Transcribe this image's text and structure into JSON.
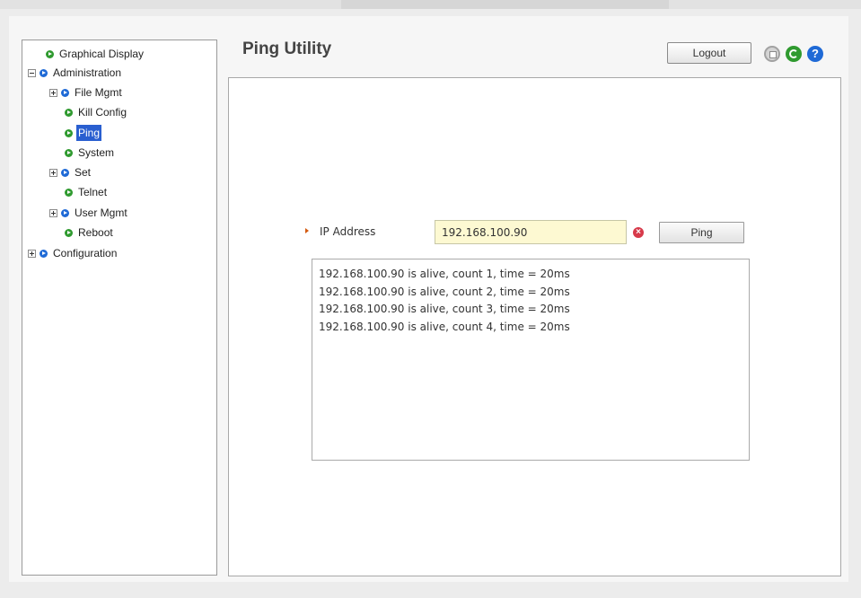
{
  "sidebar": {
    "items": [
      {
        "label": "Graphical Display",
        "expander": "none",
        "icon": "green",
        "level": 0
      },
      {
        "label": "Administration",
        "expander": "minus",
        "icon": "blue",
        "level": 0
      },
      {
        "label": "File Mgmt",
        "expander": "plus",
        "icon": "blue",
        "level": 1
      },
      {
        "label": "Kill Config",
        "expander": "none",
        "icon": "green",
        "level": 1
      },
      {
        "label": "Ping",
        "expander": "none",
        "icon": "green",
        "level": 1,
        "selected": true
      },
      {
        "label": "System",
        "expander": "none",
        "icon": "green",
        "level": 1
      },
      {
        "label": "Set",
        "expander": "plus",
        "icon": "blue",
        "level": 1
      },
      {
        "label": "Telnet",
        "expander": "none",
        "icon": "green",
        "level": 1
      },
      {
        "label": "User Mgmt",
        "expander": "plus",
        "icon": "blue",
        "level": 1
      },
      {
        "label": "Reboot",
        "expander": "none",
        "icon": "green",
        "level": 1
      },
      {
        "label": "Configuration",
        "expander": "plus",
        "icon": "blue",
        "level": 0
      }
    ]
  },
  "header": {
    "title": "Ping Utility",
    "logout_label": "Logout",
    "icons": [
      "save-icon",
      "refresh-icon",
      "help-icon"
    ],
    "help_glyph": "?"
  },
  "form": {
    "ip_label": "IP Address",
    "ip_value": "192.168.100.90",
    "ping_label": "Ping",
    "clear_glyph": "×"
  },
  "output": {
    "lines": [
      "192.168.100.90 is alive, count 1, time = 20ms",
      "192.168.100.90 is alive, count 2, time = 20ms",
      "192.168.100.90 is alive, count 3, time = 20ms",
      "192.168.100.90 is alive, count 4, time = 20ms"
    ]
  },
  "colors": {
    "accent_green": "#2f9a2f",
    "accent_blue": "#1f6ad6",
    "selected_bg": "#2a5fd0",
    "input_bg": "#fdf9d2",
    "clear_red": "#d73a4a"
  }
}
